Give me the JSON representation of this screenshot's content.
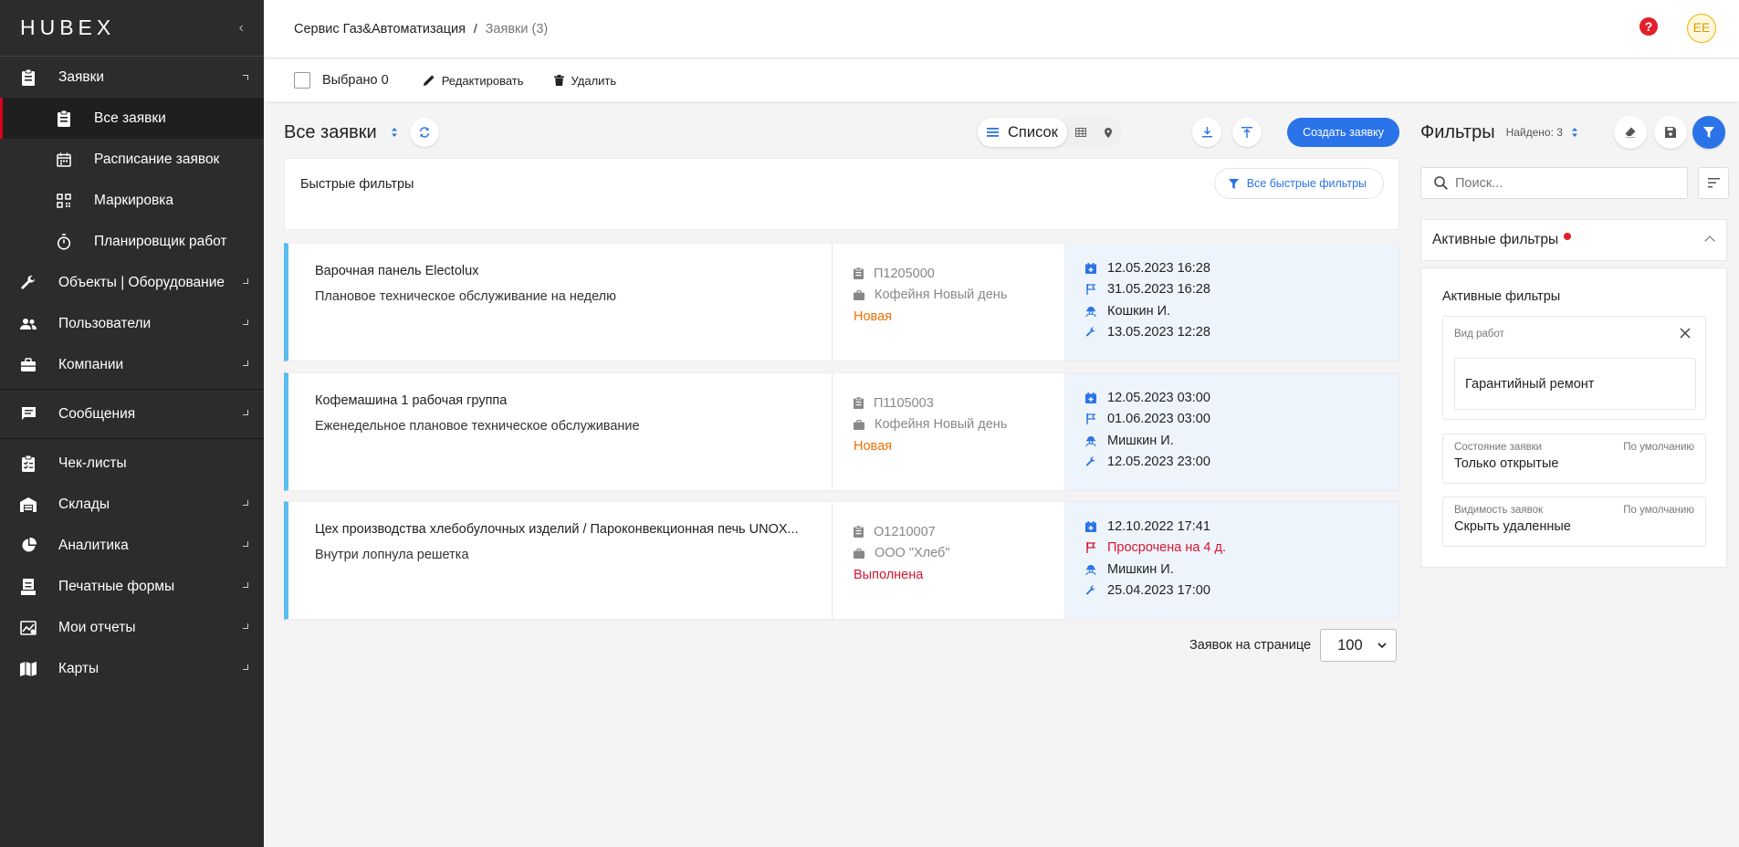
{
  "app": {
    "logo": "HUBEX",
    "collapse_icon": "‹"
  },
  "sidebar": {
    "items": [
      {
        "label": "Заявки",
        "icon": "clipboard-icon",
        "expanded": true
      },
      {
        "label": "Все заявки",
        "icon": "clipboard-list-icon",
        "sub": true,
        "active": true
      },
      {
        "label": "Расписание заявок",
        "icon": "calendar-icon",
        "sub": true
      },
      {
        "label": "Маркировка",
        "icon": "qr-code-icon",
        "sub": true
      },
      {
        "label": "Планировщик работ",
        "icon": "stopwatch-icon",
        "sub": true
      },
      {
        "label": "Объекты | Оборудование",
        "icon": "wrench-icon"
      },
      {
        "label": "Пользователи",
        "icon": "users-icon"
      },
      {
        "label": "Компании",
        "icon": "briefcase-icon"
      },
      {
        "label": "Сообщения",
        "icon": "message-icon"
      },
      {
        "label": "Чек-листы",
        "icon": "checklist-icon"
      },
      {
        "label": "Склады",
        "icon": "warehouse-icon"
      },
      {
        "label": "Аналитика",
        "icon": "pie-chart-icon"
      },
      {
        "label": "Печатные формы",
        "icon": "print-form-icon"
      },
      {
        "label": "Мои отчеты",
        "icon": "reports-icon"
      },
      {
        "label": "Карты",
        "icon": "map-icon"
      }
    ]
  },
  "topbar": {
    "breadcrumb_main": "Сервис Газ&Автоматизация",
    "breadcrumb_sep": "/",
    "breadcrumb_sub": "Заявки (3)",
    "help": "?",
    "avatar": "EE"
  },
  "toolbar": {
    "selected": "Выбрано 0",
    "edit": "Редактировать",
    "delete": "Удалить"
  },
  "main": {
    "title": "Все заявки",
    "view_list": "Список",
    "create": "Создать заявку",
    "quick_filters_title": "Быстрые фильтры",
    "all_quick_filters": "Все быстрые фильтры"
  },
  "cards": [
    {
      "title": "Варочная панель Electolux",
      "desc": "Плановое техническое обслуживание на неделю",
      "number": "П1205000",
      "company": "Кофейня Новый день",
      "status": "Новая",
      "status_type": "new",
      "created": "12.05.2023 16:28",
      "deadline": "31.05.2023 16:28",
      "deadline_overdue": false,
      "worker": "Кошкин И.",
      "work_date": "13.05.2023 12:28"
    },
    {
      "title": "Кофемашина 1 рабочая группа",
      "desc": "Еженедельное плановое техническое обслуживание",
      "number": "П1105003",
      "company": "Кофейня Новый день",
      "status": "Новая",
      "status_type": "new",
      "created": "12.05.2023 03:00",
      "deadline": "01.06.2023 03:00",
      "deadline_overdue": false,
      "worker": "Мишкин И.",
      "work_date": "12.05.2023 23:00"
    },
    {
      "title": "Цех производства хлебобулочных изделий / Пароконвекционная печь UNOX...",
      "desc": "Внутри лопнула решетка",
      "number": "О1210007",
      "company": "ООО \"Хлеб\"",
      "status": "Выполнена",
      "status_type": "done",
      "created": "12.10.2022 17:41",
      "deadline": "Просрочена на 4 д.",
      "deadline_overdue": true,
      "worker": "Мишкин И.",
      "work_date": "25.04.2023 17:00"
    }
  ],
  "pager": {
    "label": "Заявок на странице",
    "value": "100"
  },
  "filters": {
    "title": "Фильтры",
    "found": "Найдено: 3",
    "search_placeholder": "Поиск...",
    "active_header": "Активные фильтры",
    "active_panel_title": "Активные фильтры",
    "work_type_label": "Вид работ",
    "work_type_value": "Гарантийный ремонт",
    "state_label": "Состояние заявки",
    "state_default": "По умолчанию",
    "state_value": "Только открытые",
    "visibility_label": "Видимость заявок",
    "visibility_default": "По умолчанию",
    "visibility_value": "Скрыть удаленные"
  },
  "colors": {
    "accent": "#2a73e8",
    "sidebar": "#2c2c2c",
    "card_stripe": "#5bbcf0",
    "status_new": "#f07000",
    "status_done": "#d71530"
  }
}
